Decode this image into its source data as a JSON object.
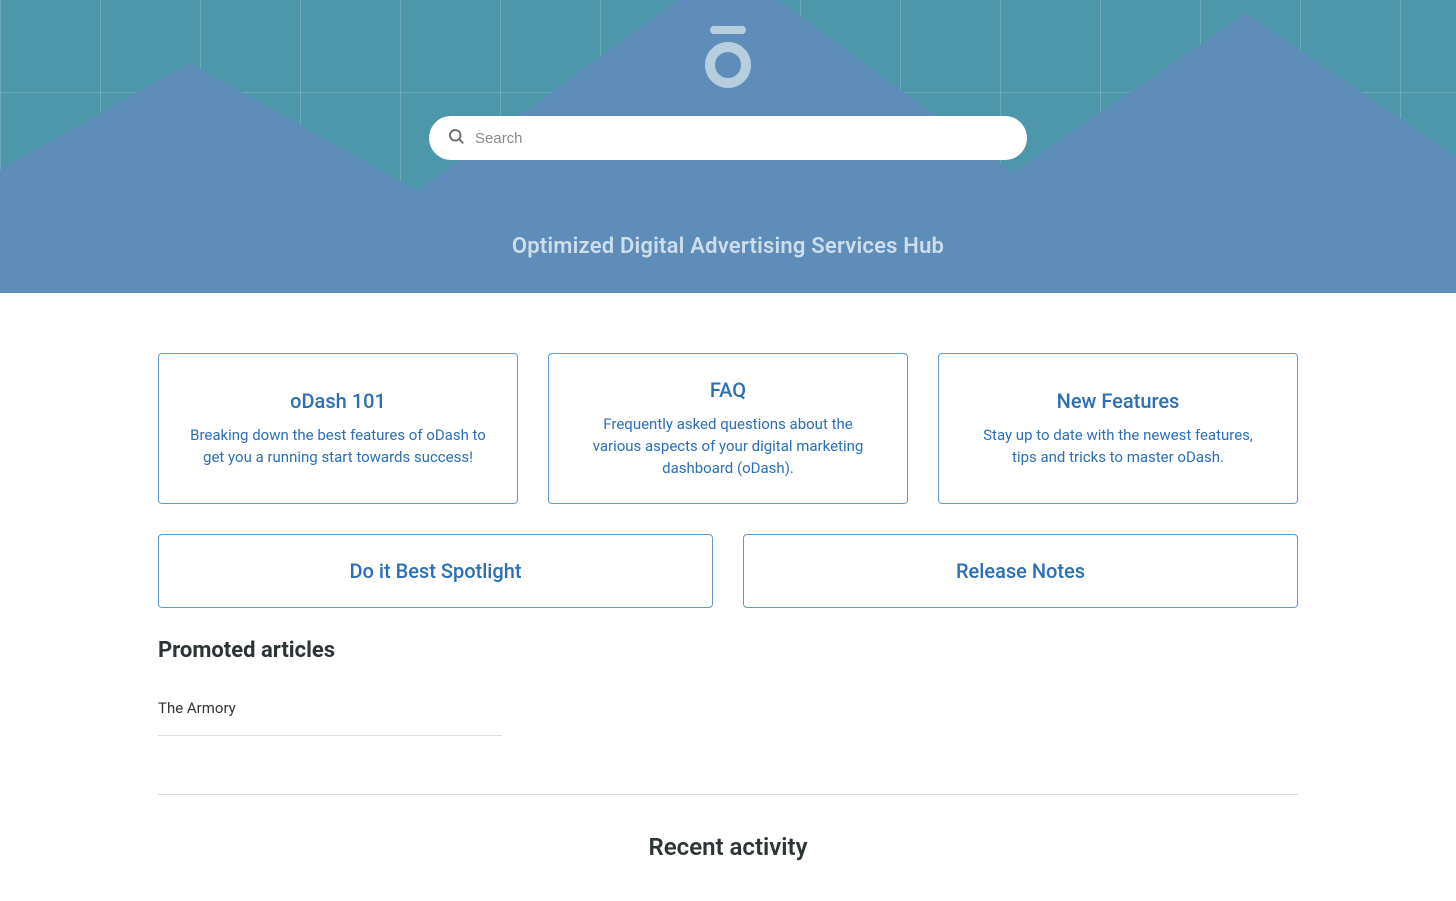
{
  "hero": {
    "tagline": "Optimized Digital Advertising Services Hub",
    "logo_name": "odash-logo"
  },
  "search": {
    "placeholder": "Search"
  },
  "cards_top": [
    {
      "title": "oDash 101",
      "desc": "Breaking down the best features of oDash to get you a running start towards success!"
    },
    {
      "title": "FAQ",
      "desc": "Frequently asked questions about the various aspects of your digital marketing dashboard (oDash)."
    },
    {
      "title": "New Features",
      "desc": "Stay up to date with the newest features, tips and tricks to master oDash."
    }
  ],
  "cards_bottom": [
    {
      "title": "Do it Best Spotlight"
    },
    {
      "title": "Release Notes"
    }
  ],
  "promoted": {
    "heading": "Promoted articles",
    "items": [
      {
        "title": "The Armory"
      }
    ]
  },
  "recent": {
    "heading": "Recent activity"
  },
  "colors": {
    "hero_bg": "#4d97aa",
    "mountain": "#5d8db8",
    "card_border": "#5c9bd1",
    "card_text": "#2c6fb5"
  }
}
